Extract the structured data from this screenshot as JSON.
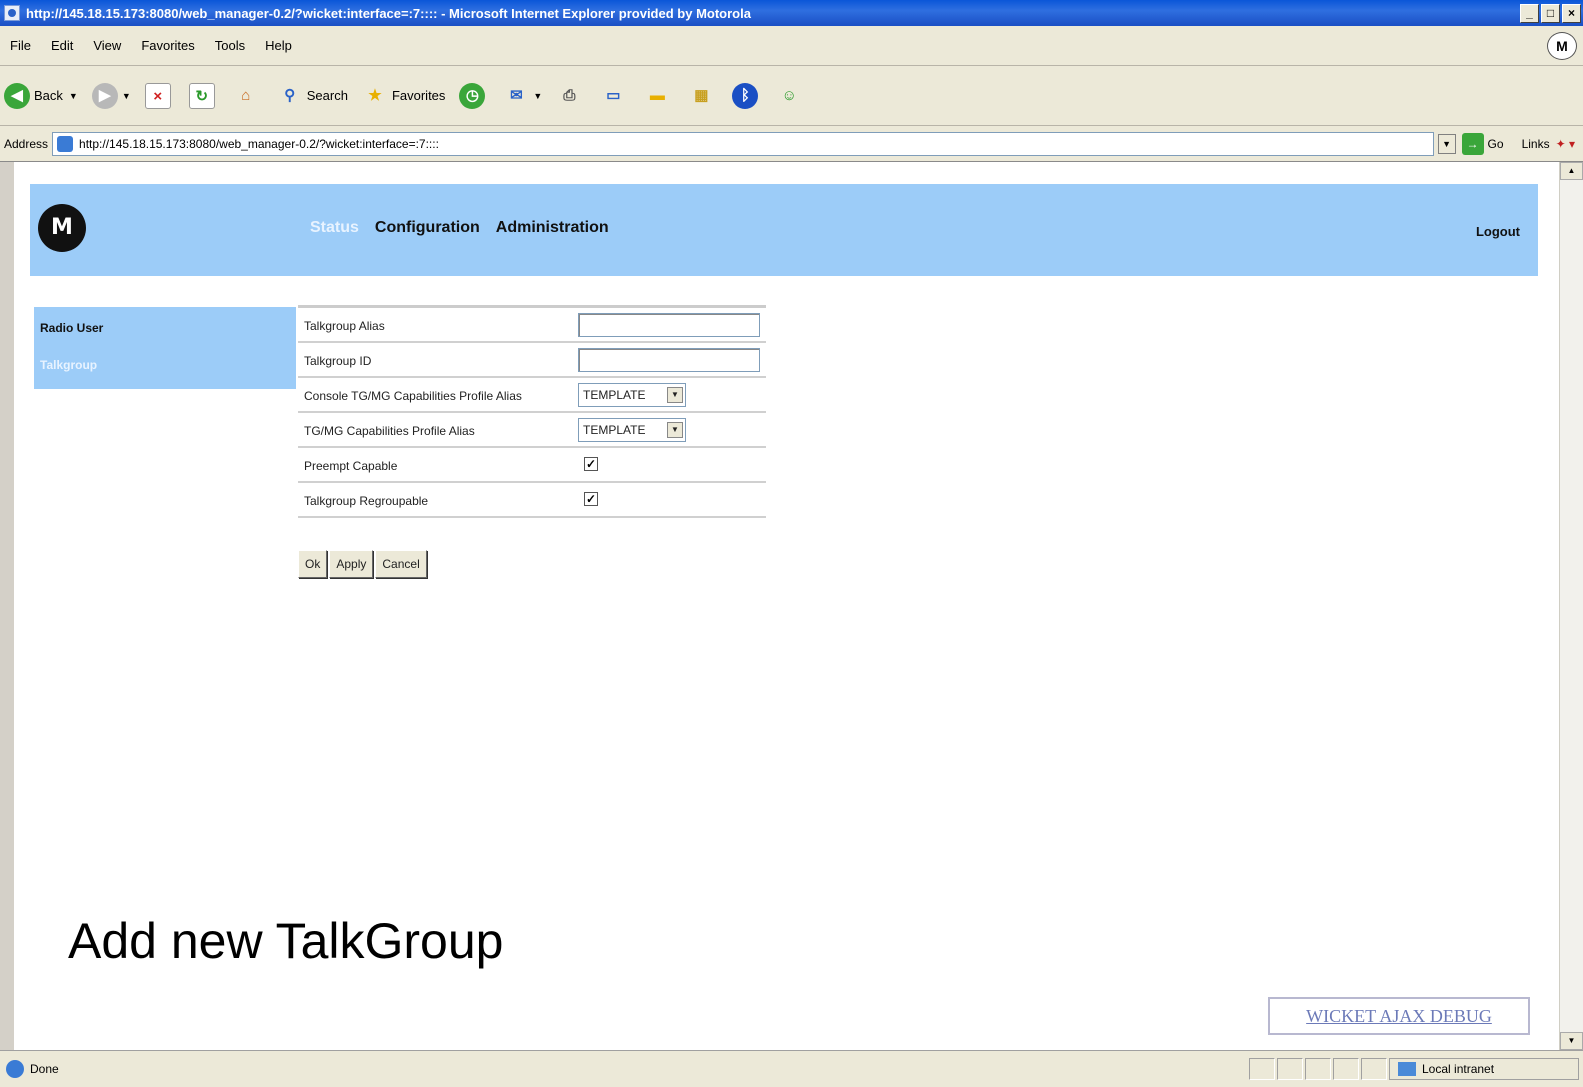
{
  "window": {
    "title": "http://145.18.15.173:8080/web_manager-0.2/?wicket:interface=:7:::: - Microsoft Internet Explorer provided by Motorola",
    "min_label": "_",
    "max_label": "□",
    "close_label": "×"
  },
  "menu": {
    "items": [
      "File",
      "Edit",
      "View",
      "Favorites",
      "Tools",
      "Help"
    ]
  },
  "toolbar": {
    "back_label": "Back",
    "search_label": "Search",
    "favorites_label": "Favorites"
  },
  "address": {
    "label": "Address",
    "url": "http://145.18.15.173:8080/web_manager-0.2/?wicket:interface=:7::::",
    "go_label": "Go",
    "links_label": "Links"
  },
  "header": {
    "nav": [
      "Status",
      "Configuration",
      "Administration"
    ],
    "logout": "Logout"
  },
  "sidebar": {
    "items": [
      "Radio User",
      "Talkgroup"
    ]
  },
  "form": {
    "rows": [
      {
        "label": "Talkgroup Alias",
        "type": "text",
        "value": ""
      },
      {
        "label": "Talkgroup ID",
        "type": "text",
        "value": ""
      },
      {
        "label": "Console TG/MG Capabilities Profile Alias",
        "type": "select",
        "value": "TEMPLATE"
      },
      {
        "label": "TG/MG Capabilities Profile Alias",
        "type": "select",
        "value": "TEMPLATE"
      },
      {
        "label": "Preempt Capable",
        "type": "checkbox",
        "checked": true
      },
      {
        "label": "Talkgroup Regroupable",
        "type": "checkbox",
        "checked": true
      }
    ],
    "buttons": [
      "Ok",
      "Apply",
      "Cancel"
    ]
  },
  "caption": "Add new TalkGroup",
  "debug_link": "WICKET AJAX DEBUG",
  "status": {
    "text": "Done",
    "zone": "Local intranet"
  },
  "colors": {
    "header_bg": "#9cccf8",
    "titlebar": "#0a56d8"
  }
}
